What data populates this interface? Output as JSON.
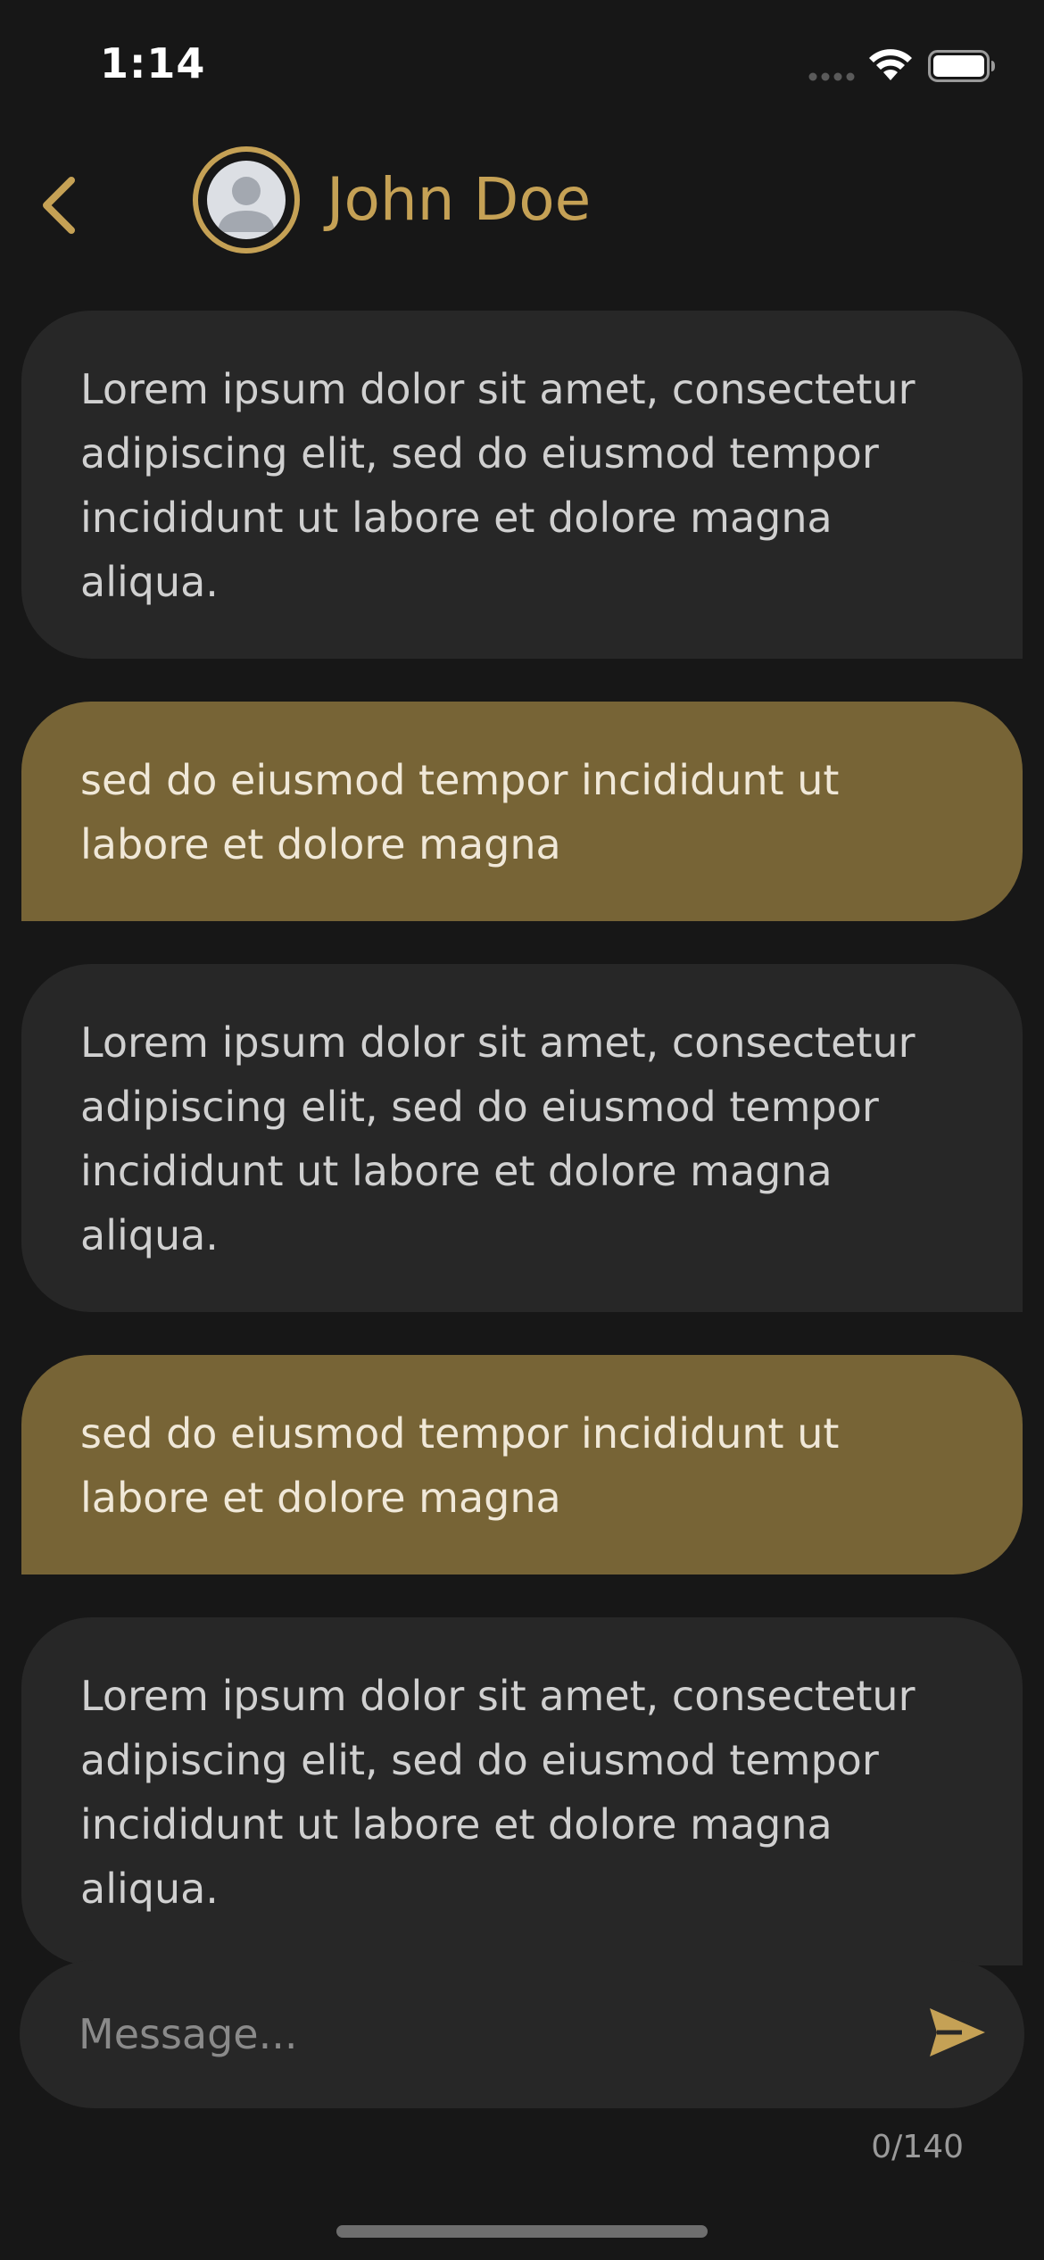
{
  "status_bar": {
    "time": "1:14",
    "icons": [
      "cellular-signal-icon",
      "wifi-icon",
      "battery-icon"
    ]
  },
  "header": {
    "back_icon": "chevron-left-icon",
    "avatar_icon": "user-avatar-icon",
    "contact_name": "John Doe"
  },
  "messages": [
    {
      "type": "received",
      "text": "Lorem ipsum dolor sit amet, consectetur adipiscing elit, sed do eiusmod tempor incididunt ut labore et dolore magna aliqua."
    },
    {
      "type": "sent",
      "text": "sed do eiusmod tempor incididunt ut labore et dolore magna"
    },
    {
      "type": "received",
      "text": "Lorem ipsum dolor sit amet, consectetur adipiscing elit, sed do eiusmod tempor incididunt ut labore et dolore magna aliqua."
    },
    {
      "type": "sent",
      "text": "sed do eiusmod tempor incididunt ut labore et dolore magna"
    },
    {
      "type": "received",
      "text": "Lorem ipsum dolor sit amet, consectetur adipiscing elit, sed do eiusmod tempor incididunt ut labore et dolore magna aliqua."
    }
  ],
  "composer": {
    "placeholder": "Message...",
    "value": "",
    "send_icon": "send-icon",
    "char_count": "0/140"
  },
  "colors": {
    "background": "#171717",
    "accent": "#c5a155",
    "received_bubble": "#272727",
    "sent_bubble": "#776436"
  }
}
